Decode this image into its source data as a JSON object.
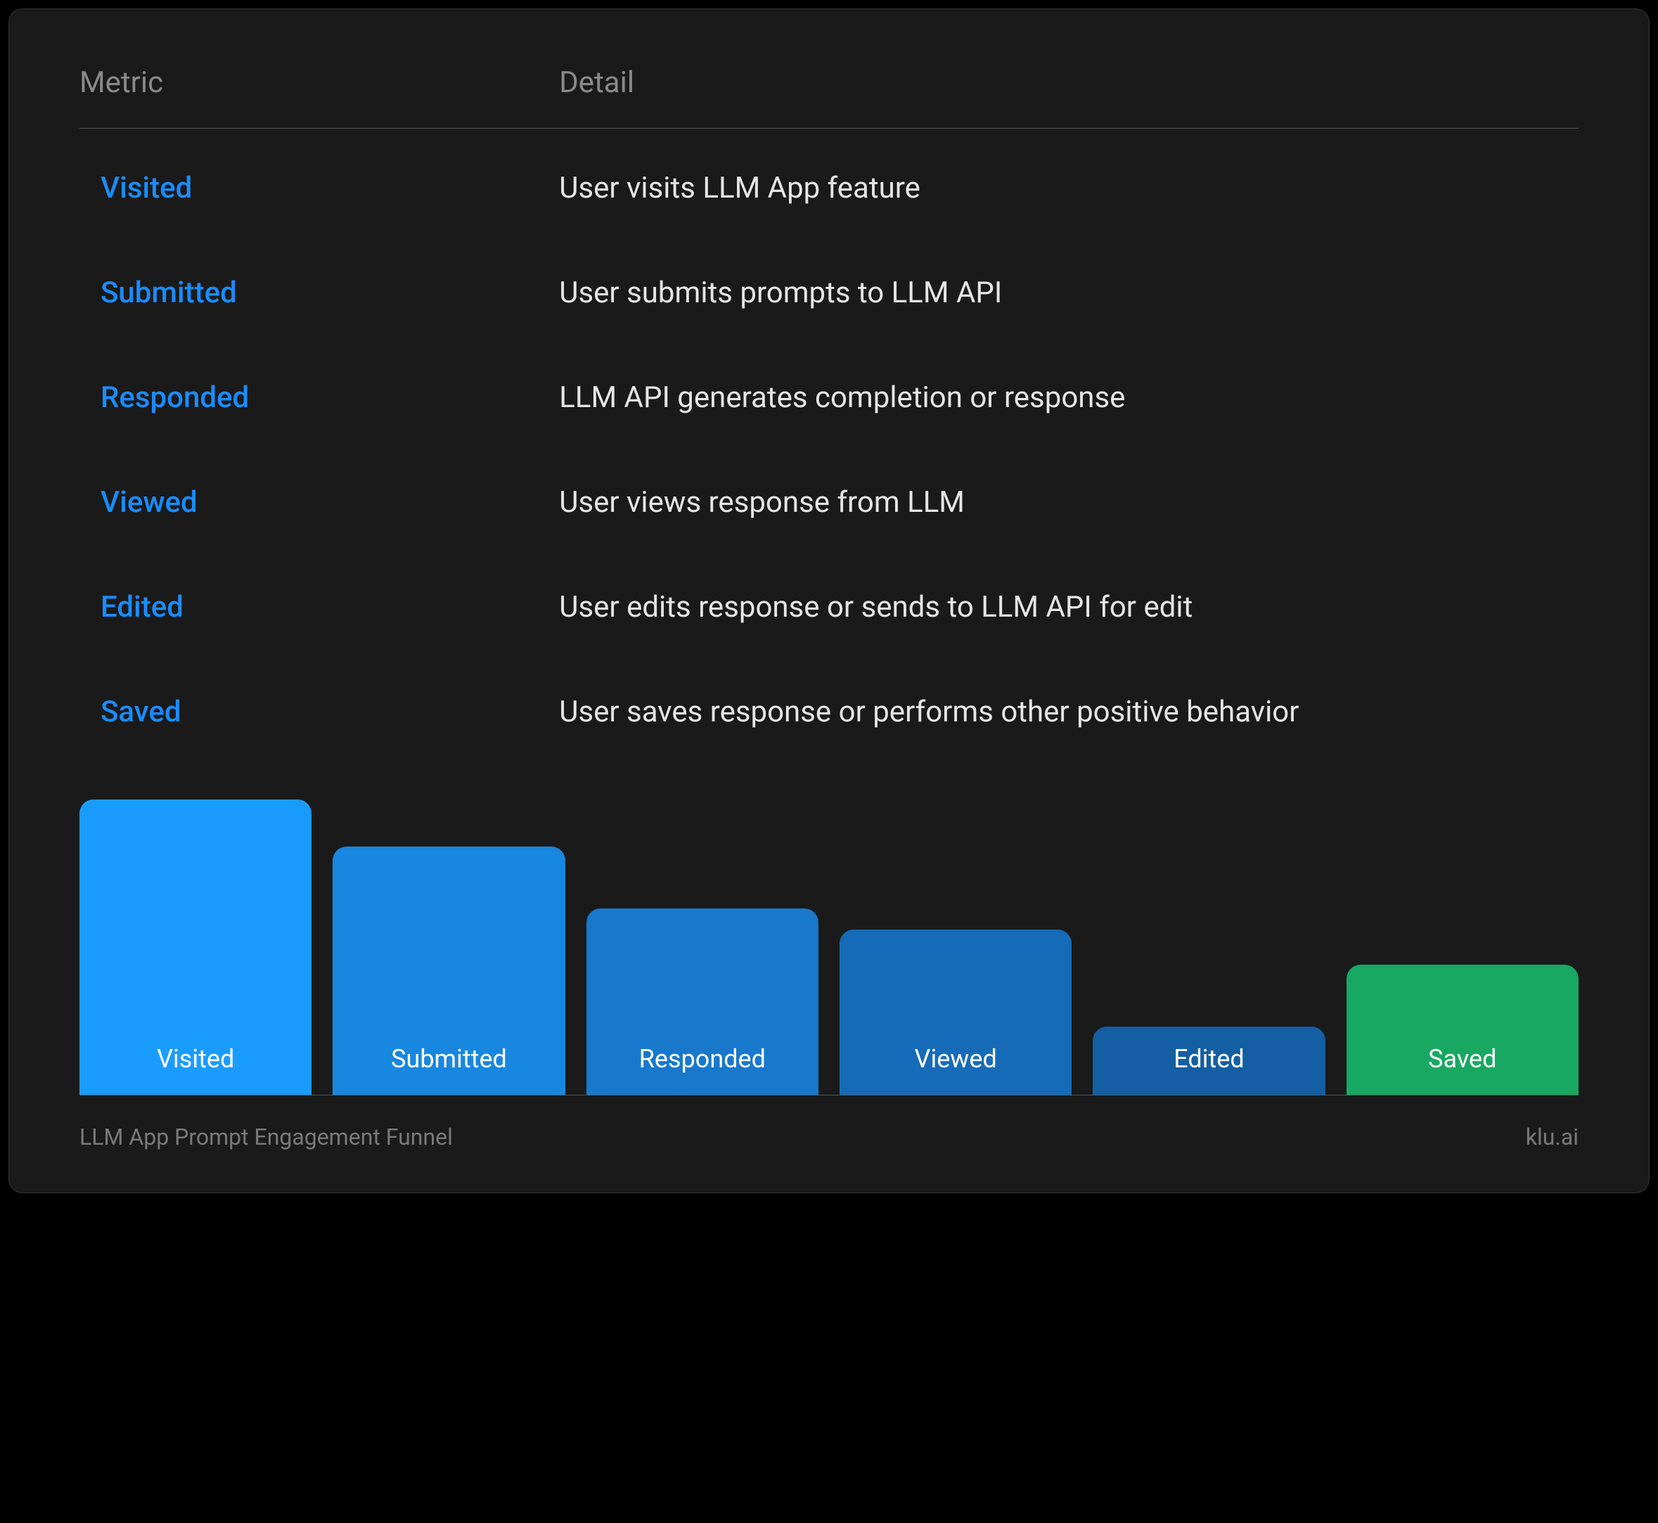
{
  "header": {
    "metric_label": "Metric",
    "detail_label": "Detail"
  },
  "rows": [
    {
      "metric": "Visited",
      "detail": "User visits LLM App feature"
    },
    {
      "metric": "Submitted",
      "detail": "User submits prompts to LLM API"
    },
    {
      "metric": "Responded",
      "detail": "LLM API generates completion or response"
    },
    {
      "metric": "Viewed",
      "detail": "User views response from LLM"
    },
    {
      "metric": "Edited",
      "detail": "User edits response or sends to LLM API for edit"
    },
    {
      "metric": "Saved",
      "detail": "User saves response or performs other positive behavior"
    }
  ],
  "chart_data": {
    "type": "bar",
    "categories": [
      "Visited",
      "Submitted",
      "Responded",
      "Viewed",
      "Edited",
      "Saved"
    ],
    "values": [
      100,
      84,
      63,
      56,
      23,
      44
    ],
    "colors": [
      "#1a9cff",
      "#1887e0",
      "#1878cc",
      "#166bb8",
      "#145ea3",
      "#18a862"
    ],
    "title": "LLM App Prompt Engagement Funnel",
    "xlabel": "",
    "ylabel": "",
    "ylim": [
      0,
      100
    ]
  },
  "footer": {
    "title": "LLM App Prompt Engagement Funnel",
    "source": "klu.ai"
  }
}
